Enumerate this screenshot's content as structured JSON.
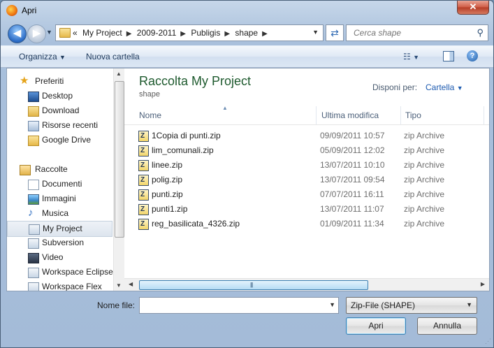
{
  "window": {
    "title": "Apri",
    "close_label": "✕"
  },
  "address": {
    "breadcrumbs": [
      "My Project",
      "2009-2011",
      "Publigis",
      "shape"
    ],
    "overflow_marker": "«"
  },
  "search": {
    "placeholder": "Cerca shape"
  },
  "toolbar": {
    "organize": "Organizza",
    "new_folder": "Nuova cartella"
  },
  "navigation": {
    "items": [
      {
        "label": "Preferiti",
        "icon": "star-icon",
        "group": true
      },
      {
        "label": "Desktop",
        "icon": "desktop-icon"
      },
      {
        "label": "Download",
        "icon": "download-folder-icon"
      },
      {
        "label": "Risorse recenti",
        "icon": "recent-places-icon"
      },
      {
        "label": "Google Drive",
        "icon": "google-drive-folder-icon"
      },
      {
        "label": "Raccolte",
        "icon": "libraries-icon",
        "group": true
      },
      {
        "label": "Documenti",
        "icon": "documents-icon"
      },
      {
        "label": "Immagini",
        "icon": "pictures-icon"
      },
      {
        "label": "Musica",
        "icon": "music-icon"
      },
      {
        "label": "My Project",
        "icon": "library-icon",
        "selected": true
      },
      {
        "label": "Subversion",
        "icon": "library-icon"
      },
      {
        "label": "Video",
        "icon": "video-icon"
      },
      {
        "label": "Workspace Eclipse",
        "icon": "library-icon"
      },
      {
        "label": "Workspace Flex",
        "icon": "library-icon"
      }
    ]
  },
  "library": {
    "title": "Raccolta My Project",
    "subtitle": "shape",
    "arrange_label": "Disponi per:",
    "arrange_value": "Cartella"
  },
  "columns": {
    "name": "Nome",
    "modified": "Ultima modifica",
    "type": "Tipo"
  },
  "files": [
    {
      "name": "1Copia di punti.zip",
      "modified": "09/09/2011 10:57",
      "type": "zip Archive"
    },
    {
      "name": "lim_comunali.zip",
      "modified": "05/09/2011 12:02",
      "type": "zip Archive"
    },
    {
      "name": "linee.zip",
      "modified": "13/07/2011 10:10",
      "type": "zip Archive"
    },
    {
      "name": "polig.zip",
      "modified": "13/07/2011 09:54",
      "type": "zip Archive"
    },
    {
      "name": "punti.zip",
      "modified": "07/07/2011 16:11",
      "type": "zip Archive"
    },
    {
      "name": "punti1.zip",
      "modified": "13/07/2011 11:07",
      "type": "zip Archive"
    },
    {
      "name": "reg_basilicata_4326.zip",
      "modified": "01/09/2011 11:34",
      "type": "zip Archive"
    }
  ],
  "bottom": {
    "file_name_label": "Nome file:",
    "file_name_value": "",
    "filter_value": "Zip-File (SHAPE)",
    "open_button": "Apri",
    "cancel_button": "Annulla"
  },
  "colors": {
    "accent": "#1e5a2e",
    "link": "#1e5bb0",
    "selection": "#dde5ee"
  }
}
